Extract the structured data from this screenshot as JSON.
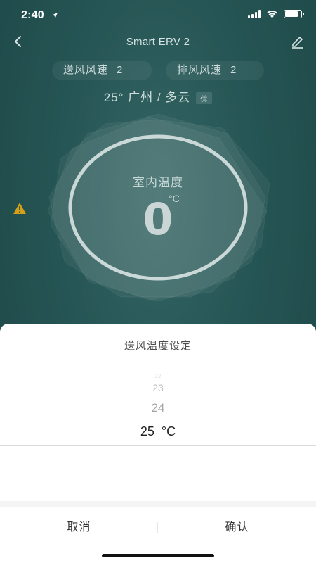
{
  "status_bar": {
    "time": "2:40"
  },
  "nav": {
    "title": "Smart ERV 2"
  },
  "fan": {
    "supply_label": "送风风速",
    "supply_value": "2",
    "exhaust_label": "排风风速",
    "exhaust_value": "2"
  },
  "weather": {
    "text": "25°  广州 / 多云",
    "air_quality": "优"
  },
  "indoor": {
    "label": "室内温度",
    "value": "0",
    "unit": "°C"
  },
  "sheet": {
    "title": "送风温度设定",
    "picker": {
      "faint": "22",
      "prev2": "23",
      "prev1": "24",
      "selected": "25",
      "unit": "°C"
    },
    "cancel": "取消",
    "confirm": "确认"
  },
  "colors": {
    "background": "#2e6867",
    "sheet": "#ffffff",
    "warning": "#d4a017"
  }
}
